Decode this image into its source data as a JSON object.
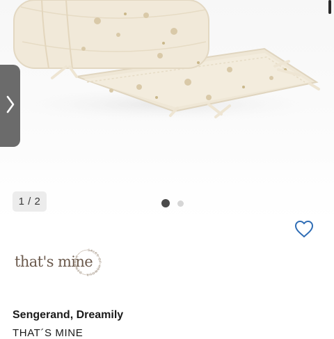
{
  "gallery": {
    "counter": "1 / 2",
    "current_slide": 1,
    "total_slides": 2,
    "image_alt": "Sengerand, Dreamily product image",
    "next_icon": "chevron-right-icon"
  },
  "wishlist": {
    "icon": "heart-outline-icon",
    "color": "#2f6db5"
  },
  "brand": {
    "logo_text": "that's mine",
    "seal_text": "SALES OF HONOUR · DENMARK ·",
    "logo_color": "#6b5a4d"
  },
  "product": {
    "title": "Sengerand, Dreamily",
    "brand_name": "THAT´S MINE"
  }
}
